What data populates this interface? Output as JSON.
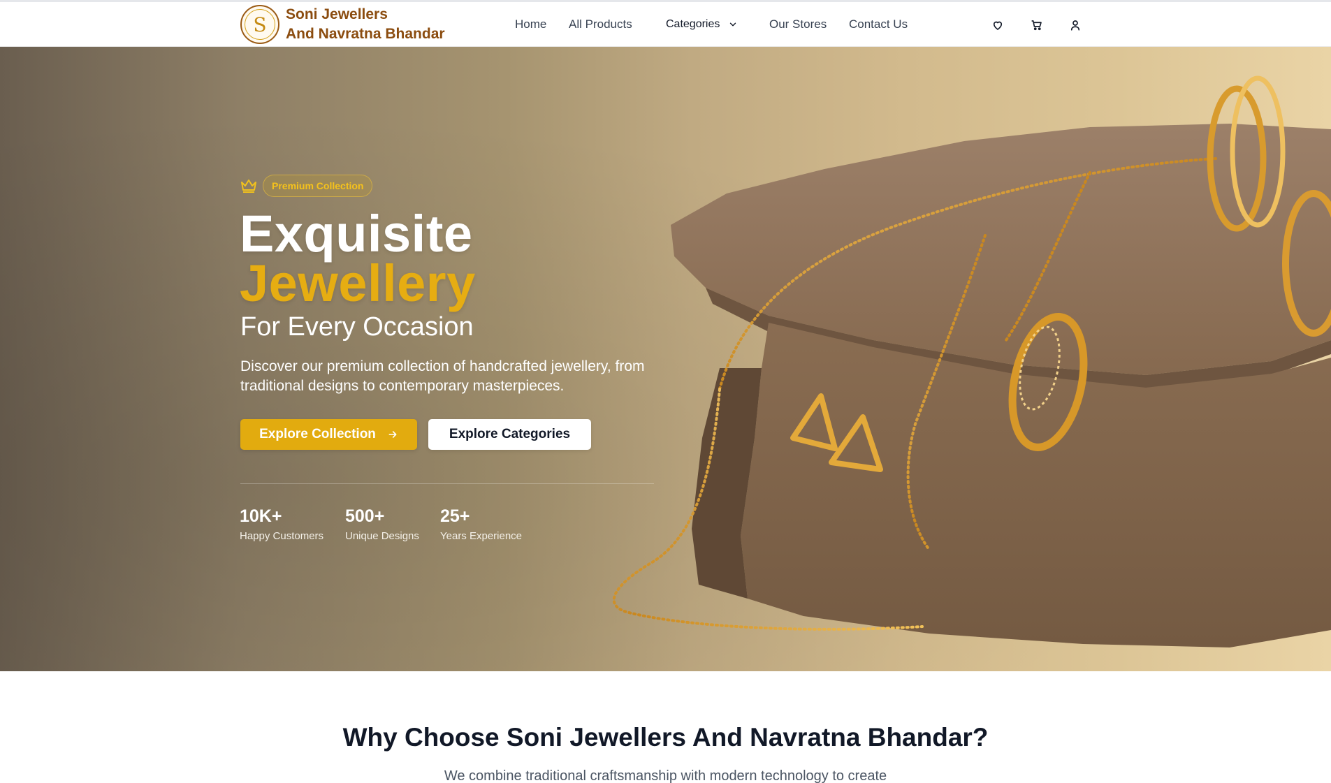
{
  "brand": {
    "line1": "Soni Jewellers",
    "line2": "And Navratna Bhandar",
    "logo_glyph": "S",
    "colors": {
      "brand_brown": "#8b4c0f",
      "gold": "#e2ab0f"
    }
  },
  "nav": {
    "home": "Home",
    "all_products": "All Products",
    "categories": "Categories",
    "our_stores": "Our Stores",
    "contact_us": "Contact Us"
  },
  "header_icons": [
    "heart-icon",
    "cart-icon",
    "user-icon"
  ],
  "hero": {
    "badge": "Premium Collection",
    "title_line1": "Exquisite",
    "title_line2": "Jewellery",
    "subtitle": "For Every Occasion",
    "description": "Discover our premium collection of handcrafted jewellery, from traditional designs to contemporary masterpieces.",
    "primary_button": "Explore Collection",
    "secondary_button": "Explore Categories",
    "stats": [
      {
        "value": "10K+",
        "label": "Happy Customers"
      },
      {
        "value": "500+",
        "label": "Unique Designs"
      },
      {
        "value": "25+",
        "label": "Years Experience"
      }
    ]
  },
  "why": {
    "title": "Why Choose Soni Jewellers And Navratna Bhandar?",
    "description": "We combine traditional craftsmanship with modern technology to create"
  }
}
